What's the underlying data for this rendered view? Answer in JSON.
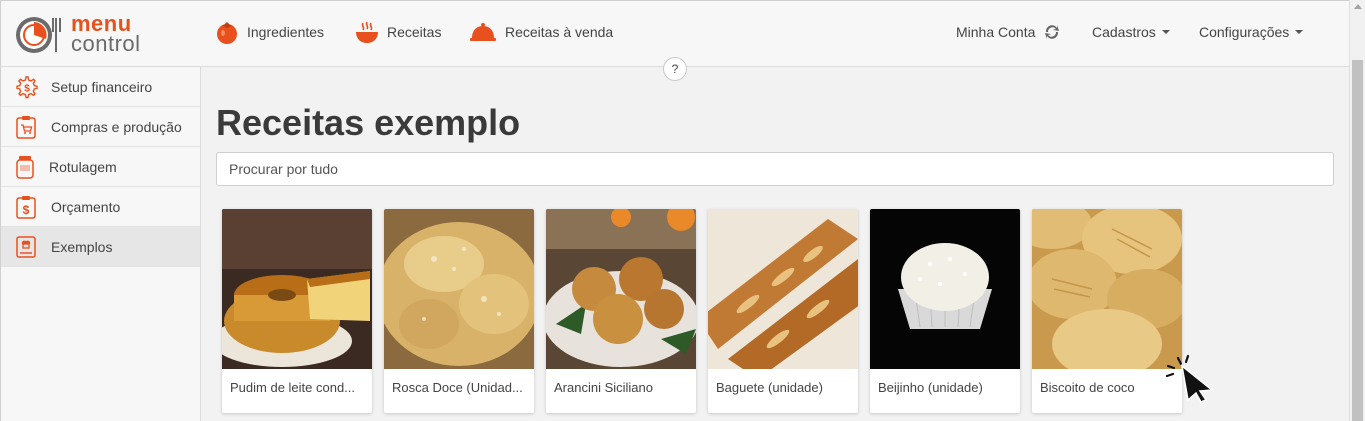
{
  "brand": {
    "line1": "menu",
    "line2": "control",
    "accent": "#e8501e"
  },
  "nav": {
    "ingredientes": "Ingredientes",
    "receitas": "Receitas",
    "receitas_venda": "Receitas à venda",
    "minha_conta": "Minha Conta",
    "cadastros": "Cadastros",
    "configuracoes": "Configurações",
    "help": "?"
  },
  "sidebar": {
    "items": [
      {
        "label": "Setup financeiro",
        "icon": "gear-dollar-icon"
      },
      {
        "label": "Compras e produção",
        "icon": "clipboard-cart-icon"
      },
      {
        "label": "Rotulagem",
        "icon": "jar-icon"
      },
      {
        "label": "Orçamento",
        "icon": "clipboard-dollar-icon"
      },
      {
        "label": "Exemplos",
        "icon": "book-chef-icon",
        "active": true
      }
    ]
  },
  "main": {
    "title": "Receitas exemplo",
    "search_placeholder": "Procurar por tudo",
    "cards": [
      {
        "name": "Pudim de leite cond..."
      },
      {
        "name": "Rosca Doce (Unidad..."
      },
      {
        "name": "Arancini Siciliano"
      },
      {
        "name": "Baguete (unidade)"
      },
      {
        "name": "Beijinho (unidade)"
      },
      {
        "name": "Biscoito de coco"
      }
    ]
  }
}
